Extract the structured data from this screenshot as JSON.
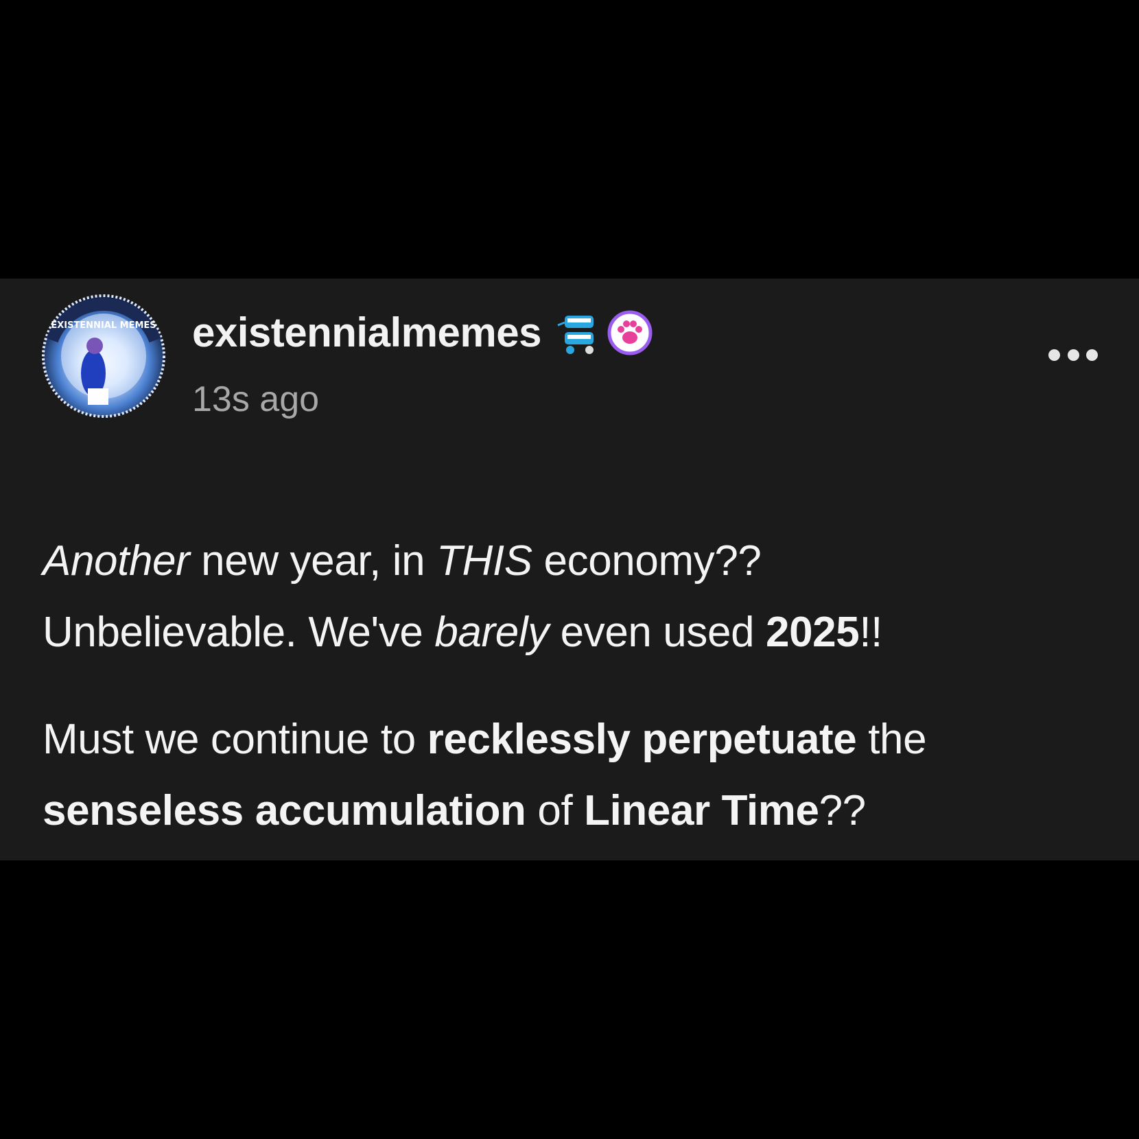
{
  "post": {
    "username": "existennialmemes",
    "timestamp": "13s ago",
    "avatar_text": "EXISTENNIAL MEMES",
    "badges": [
      "chattering-teeth-icon",
      "paw-icon"
    ],
    "more_menu": "more-options-icon",
    "body": {
      "paragraph_1": {
        "s1": "Another",
        "s2": " new year, in ",
        "s3": "THIS",
        "s4": " economy??",
        "s5": "Unbelievable. We've ",
        "s6": "barely",
        "s7": " even used ",
        "s8": "2025",
        "s9": "!!"
      },
      "paragraph_2": {
        "s1": "Must we continue to ",
        "s2": "recklessly perpetuate",
        "s3": " the ",
        "s4": "senseless accumulation",
        "s5": " of ",
        "s6": "Linear Time",
        "s7": "??"
      }
    }
  },
  "colors": {
    "page_background": "#000000",
    "card_background": "#1b1b1b",
    "text_primary": "#f4f4f4",
    "text_secondary": "#a8a8a8",
    "paw_badge_border": "#9b5cf0",
    "paw_badge_paw": "#e8409a",
    "teeth_badge": "#2aa6e0"
  }
}
